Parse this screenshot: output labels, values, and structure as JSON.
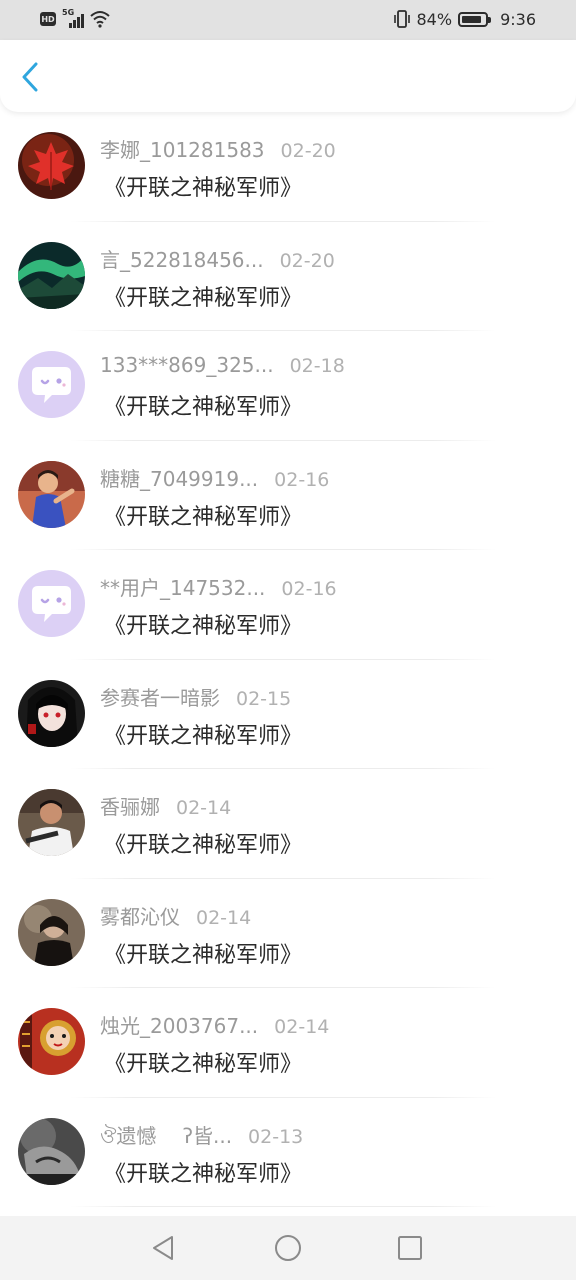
{
  "status_bar": {
    "hd": "HD",
    "network": "5G",
    "battery_percent": "84%",
    "battery_level": 0.84,
    "time": "9:36"
  },
  "header": {
    "back_icon": "chevron-left-icon",
    "accent_color": "#2fa6de"
  },
  "list": [
    {
      "name": "李娜_101281583",
      "date": "02-20",
      "title": "《开联之神秘军师》",
      "avatar": "red-maple-leaf"
    },
    {
      "name": "言_522818456...",
      "date": "02-20",
      "title": "《开联之神秘军师》",
      "avatar": "aurora-landscape"
    },
    {
      "name": "133***869_325...",
      "date": "02-18",
      "title": "《开联之神秘军师》",
      "avatar": "default-chat-bubble"
    },
    {
      "name": "糖糖_7049919...",
      "date": "02-16",
      "title": "《开联之神秘军师》",
      "avatar": "girl-photo"
    },
    {
      "name": "**用户_147532...",
      "date": "02-16",
      "title": "《开联之神秘军师》",
      "avatar": "default-chat-bubble"
    },
    {
      "name": "参赛者一暗影",
      "date": "02-15",
      "title": "《开联之神秘军师》",
      "avatar": "anime-girl"
    },
    {
      "name": "香骊娜",
      "date": "02-14",
      "title": "《开联之神秘军师》",
      "avatar": "man-photo"
    },
    {
      "name": "雾都沁仪",
      "date": "02-14",
      "title": "《开联之神秘军师》",
      "avatar": "dark-portrait"
    },
    {
      "name": "烛光_2003767...",
      "date": "02-14",
      "title": "《开联之神秘军师》",
      "avatar": "opera-mask"
    },
    {
      "name": "ঔ遗憾　 ʔ皆...",
      "date": "02-13",
      "title": "《开联之神秘军师》",
      "avatar": "grayscale-portrait"
    }
  ],
  "nav_bar": {
    "back": "triangle-back-icon",
    "home": "circle-home-icon",
    "recents": "square-recents-icon"
  }
}
